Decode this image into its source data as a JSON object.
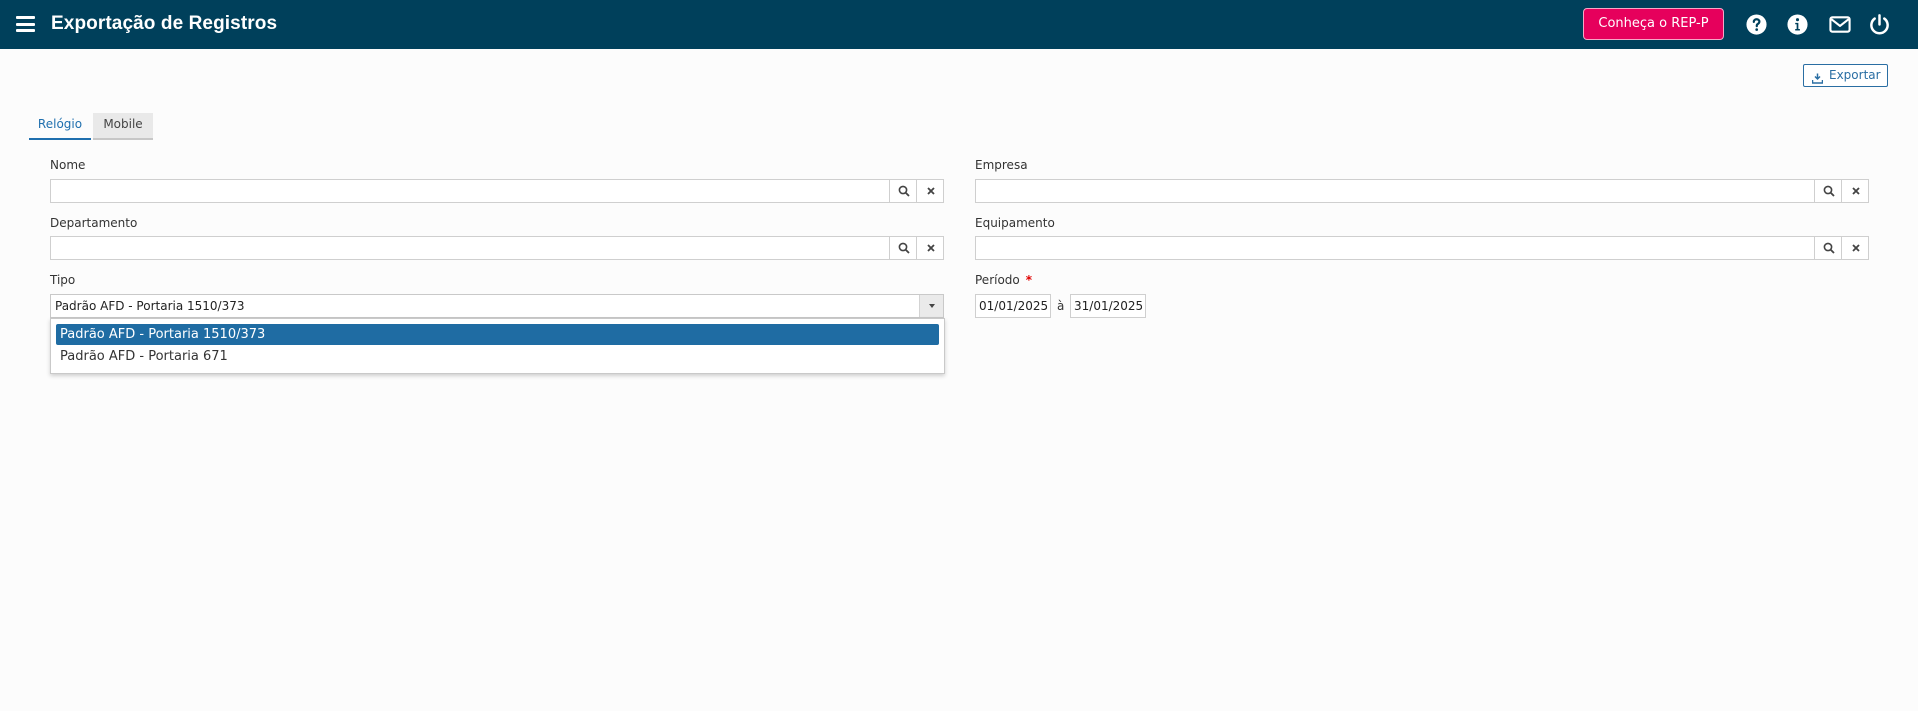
{
  "header": {
    "title": "Exportação de Registros",
    "rep_button_label": "Conheça o REP-P",
    "icons": [
      "menu-icon",
      "help-icon",
      "info-icon",
      "mail-icon",
      "power-icon"
    ],
    "background": "#00405b",
    "accent": "#e6005c"
  },
  "toolbar": {
    "export_label": "Exportar"
  },
  "tabs": [
    {
      "label": "Relógio",
      "active": true
    },
    {
      "label": "Mobile",
      "active": false
    }
  ],
  "form": {
    "nome_label": "Nome",
    "nome_value": "",
    "empresa_label": "Empresa",
    "empresa_value": "",
    "departamento_label": "Departamento",
    "departamento_value": "",
    "equipamento_label": "Equipamento",
    "equipamento_value": "",
    "tipo_label": "Tipo",
    "tipo_value": "Padrão AFD - Portaria 1510/373",
    "tipo_options": [
      "Padrão AFD - Portaria 1510/373",
      "Padrão AFD - Portaria 671"
    ],
    "periodo_label": "Período",
    "periodo_required": "*",
    "periodo_start": "01/01/2025",
    "periodo_separator": "à",
    "periodo_end": "31/01/2025"
  }
}
